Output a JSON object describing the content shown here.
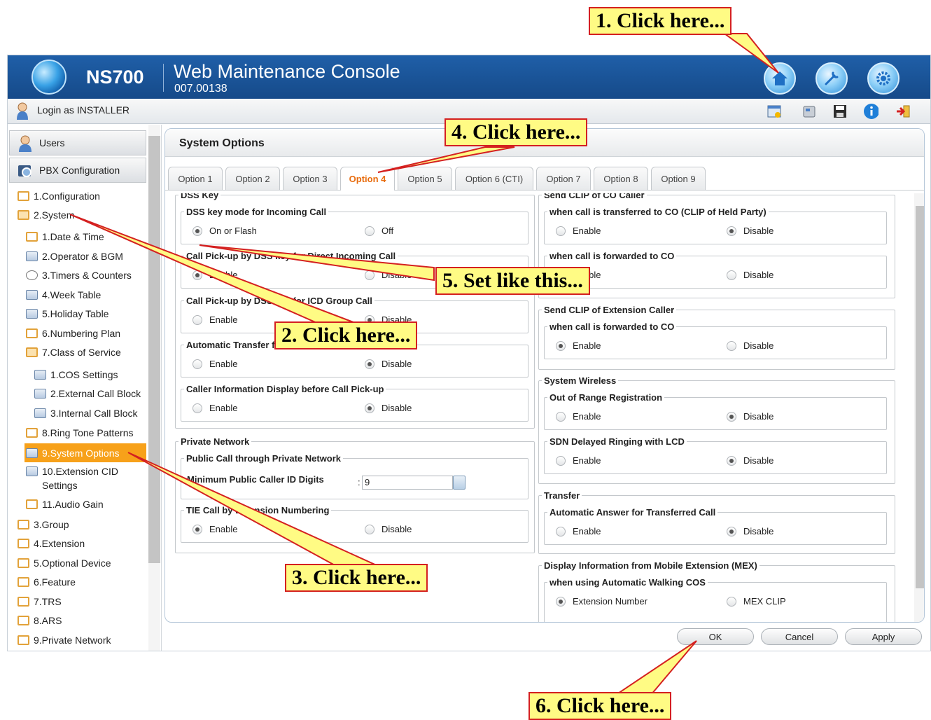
{
  "header": {
    "brand": "NS700",
    "title": "Web Maintenance Console",
    "version": "007.00138"
  },
  "subbar": {
    "login_text": "Login as INSTALLER"
  },
  "sidebar": {
    "headers": [
      "Users",
      "PBX Configuration"
    ],
    "tree": [
      "1.Configuration",
      "2.System",
      "1.Date & Time",
      "2.Operator & BGM",
      "3.Timers & Counters",
      "4.Week Table",
      "5.Holiday Table",
      "6.Numbering Plan",
      "7.Class of Service",
      "1.COS Settings",
      "2.External Call Block",
      "3.Internal Call Block",
      "8.Ring Tone Patterns",
      "9.System Options",
      "10.Extension CID",
      "Settings",
      "11.Audio Gain",
      "3.Group",
      "4.Extension",
      "5.Optional Device",
      "6.Feature",
      "7.TRS",
      "8.ARS",
      "9.Private Network"
    ]
  },
  "content": {
    "title": "System Options"
  },
  "tabs": [
    "Option 1",
    "Option 2",
    "Option 3",
    "Option 4",
    "Option 5",
    "Option 6 (CTI)",
    "Option 7",
    "Option 8",
    "Option 9"
  ],
  "left": {
    "dss_key": "DSS Key",
    "dss_mode": "DSS key mode for Incoming Call",
    "on_or_flash": "On or Flash",
    "off": "Off",
    "pickup_direct": "Call Pick-up by DSS key for Direct Incoming Call",
    "pickup_icd": "Call Pick-up by DSS key for ICD Group Call",
    "auto_transfer": "Automatic Transfer for Extension Call",
    "caller_info": "Caller Information Display before Call Pick-up",
    "private_network": "Private Network",
    "public_call": "Public Call through Private Network",
    "min_digits": "Minimum Public Caller ID Digits",
    "colon": ":",
    "min_digits_value": "9",
    "tie_call": "TIE Call by Extension Numbering",
    "enable": "Enable",
    "disable": "Disable"
  },
  "right": {
    "send_clip_co": "Send CLIP of CO Caller",
    "held_party": "when call is transferred to CO (CLIP of Held Party)",
    "forwarded_co": "when call is forwarded to CO",
    "send_clip_ext": "Send CLIP of Extension Caller",
    "forwarded_co2": "when call is forwarded to CO",
    "system_wireless": "System Wireless",
    "out_of_range": "Out of Range Registration",
    "sdn_delayed": "SDN Delayed Ringing with LCD",
    "transfer": "Transfer",
    "auto_answer": "Automatic Answer for Transferred Call",
    "mex_display": "Display Information from Mobile Extension (MEX)",
    "walking_cos": "when using Automatic Walking COS",
    "ext_number": "Extension Number",
    "mex_clip": "MEX CLIP",
    "enable": "Enable",
    "disable": "Disable"
  },
  "buttons": {
    "ok": "OK",
    "cancel": "Cancel",
    "apply": "Apply"
  },
  "callouts": [
    "1. Click here...",
    "2. Click here...",
    "3. Click here...",
    "4. Click here...",
    "5. Set like this...",
    "6. Click here..."
  ],
  "colors": {
    "header": "#1f5fa8",
    "selected": "#f7a11a",
    "active_tab": "#e86c0e",
    "callout_bg": "#fffb84",
    "callout_border": "#d42020"
  }
}
